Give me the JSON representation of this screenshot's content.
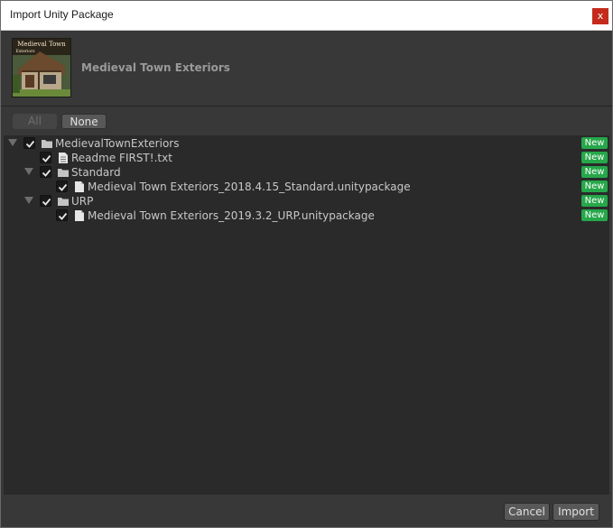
{
  "window": {
    "title": "Import Unity Package",
    "close_label": "x"
  },
  "package": {
    "name": "Medieval Town Exteriors",
    "thumbnail_caption": "Medieval Town",
    "thumbnail_subcaption": "Exteriors"
  },
  "toolbar": {
    "all_label": "All",
    "none_label": "None"
  },
  "tree": {
    "items": [
      {
        "label": "MedievalTownExteriors",
        "type": "folder",
        "checked": true,
        "expanded": true,
        "badge": "New"
      },
      {
        "label": "Readme FIRST!.txt",
        "type": "text-file",
        "checked": true,
        "badge": "New"
      },
      {
        "label": "Standard",
        "type": "folder",
        "checked": true,
        "expanded": true,
        "badge": "New"
      },
      {
        "label": "Medieval Town Exteriors_2018.4.15_Standard.unitypackage",
        "type": "file",
        "checked": true,
        "badge": "New"
      },
      {
        "label": "URP",
        "type": "folder",
        "checked": true,
        "expanded": true,
        "badge": "New"
      },
      {
        "label": "Medieval Town Exteriors_2019.3.2_URP.unitypackage",
        "type": "file",
        "checked": true,
        "badge": "New"
      }
    ]
  },
  "footer": {
    "cancel_label": "Cancel",
    "import_label": "Import"
  },
  "colors": {
    "badge": "#26a74a",
    "close": "#c42b1c",
    "panel": "#383838",
    "tree_bg": "#2a2a2a"
  }
}
